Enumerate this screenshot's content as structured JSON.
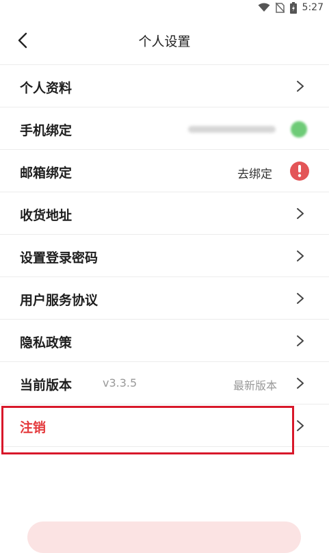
{
  "status_bar": {
    "time": "5:27"
  },
  "header": {
    "title": "个人设置"
  },
  "rows": [
    {
      "label": "个人资料"
    },
    {
      "label": "手机绑定"
    },
    {
      "label": "邮箱绑定",
      "right_text": "去绑定"
    },
    {
      "label": "收货地址"
    },
    {
      "label": "设置登录密码"
    },
    {
      "label": "用户服务协议"
    },
    {
      "label": "隐私政策"
    },
    {
      "label": "当前版本",
      "version": "v3.3.5",
      "right_text": "最新版本"
    },
    {
      "label": "注销"
    }
  ],
  "colors": {
    "accent_red": "#e4393c",
    "alert_red": "#e35557",
    "highlight_border": "#d8182a",
    "status_green": "#6ecb77"
  },
  "icons": [
    "wifi-icon",
    "no-sim-icon",
    "battery-icon",
    "back-arrow-icon",
    "chevron-right-icon",
    "alert-icon"
  ]
}
